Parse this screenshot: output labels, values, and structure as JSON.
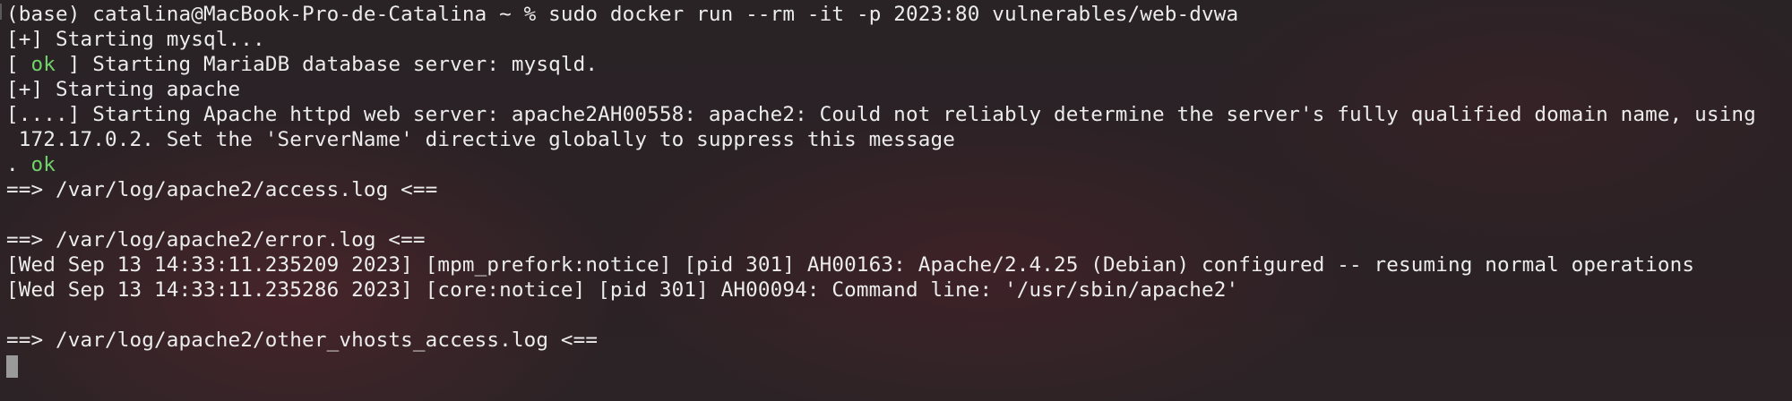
{
  "terminal": {
    "prompt": "(base) catalina@MacBook-Pro-de-Catalina ~ % ",
    "command": "sudo docker run --rm -it -p 2023:80 vulnerables/web-dvwa",
    "line_mysql_start": "[+] Starting mysql...",
    "line_mariadb_open": "[ ",
    "line_mariadb_ok": "ok",
    "line_mariadb_rest": " ] Starting MariaDB database server: mysqld.",
    "line_apache_start": "[+] Starting apache",
    "line_apache_httpd": "[....] Starting Apache httpd web server: apache2AH00558: apache2: Could not reliably determine the server's fully qualified domain name, using",
    "line_apache_httpd_cont": " 172.17.0.2. Set the 'ServerName' directive globally to suppress this message",
    "line_ok_prefix": ". ",
    "line_ok_text": "ok",
    "line_access_log": "==> /var/log/apache2/access.log <==",
    "line_error_log": "==> /var/log/apache2/error.log <==",
    "line_error_1": "[Wed Sep 13 14:33:11.235209 2023] [mpm_prefork:notice] [pid 301] AH00163: Apache/2.4.25 (Debian) configured -- resuming normal operations",
    "line_error_2": "[Wed Sep 13 14:33:11.235286 2023] [core:notice] [pid 301] AH00094: Command line: '/usr/sbin/apache2'",
    "line_vhosts_log": "==> /var/log/apache2/other_vhosts_access.log <=="
  },
  "colors": {
    "ok_green": "#6fd36a",
    "text": "#ececec",
    "cursor": "#9a9a9a"
  }
}
